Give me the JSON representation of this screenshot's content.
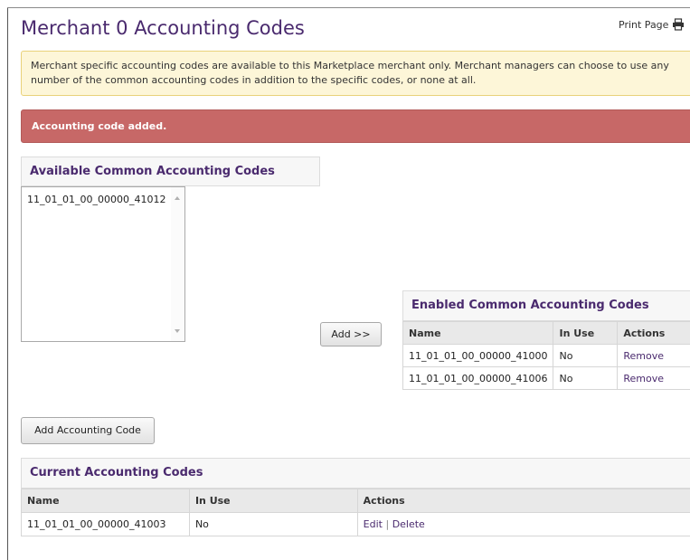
{
  "page": {
    "title": "Merchant 0 Accounting Codes",
    "print_label": "Print Page",
    "print_icon": "printer-icon"
  },
  "info_text": "Merchant specific accounting codes are available to this Marketplace merchant only. Merchant managers can choose to use any number of the common accounting codes in addition to the specific codes, or none at all.",
  "alert_text": "Accounting code added.",
  "available": {
    "title": "Available Common Accounting Codes",
    "items": [
      "11_01_01_00_00000_41012"
    ]
  },
  "add_button": "Add >>",
  "enabled": {
    "title": "Enabled Common Accounting Codes",
    "columns": [
      "Name",
      "In Use",
      "Actions"
    ],
    "rows": [
      {
        "name": "11_01_01_00_00000_41000",
        "in_use": "No",
        "action": "Remove"
      },
      {
        "name": "11_01_01_00_00000_41006",
        "in_use": "No",
        "action": "Remove"
      }
    ]
  },
  "add_accounting_code_button": "Add Accounting Code",
  "current": {
    "title": "Current Accounting Codes",
    "columns": [
      "Name",
      "In Use",
      "Actions"
    ],
    "rows": [
      {
        "name": "11_01_01_00_00000_41003",
        "in_use": "No",
        "edit": "Edit",
        "separator": "|",
        "delete": "Delete"
      }
    ]
  },
  "colors": {
    "title": "#4a2a6e",
    "alert_bg": "#c76867",
    "info_bg": "#fdf6d8",
    "header_bg": "#e9e9e9"
  }
}
